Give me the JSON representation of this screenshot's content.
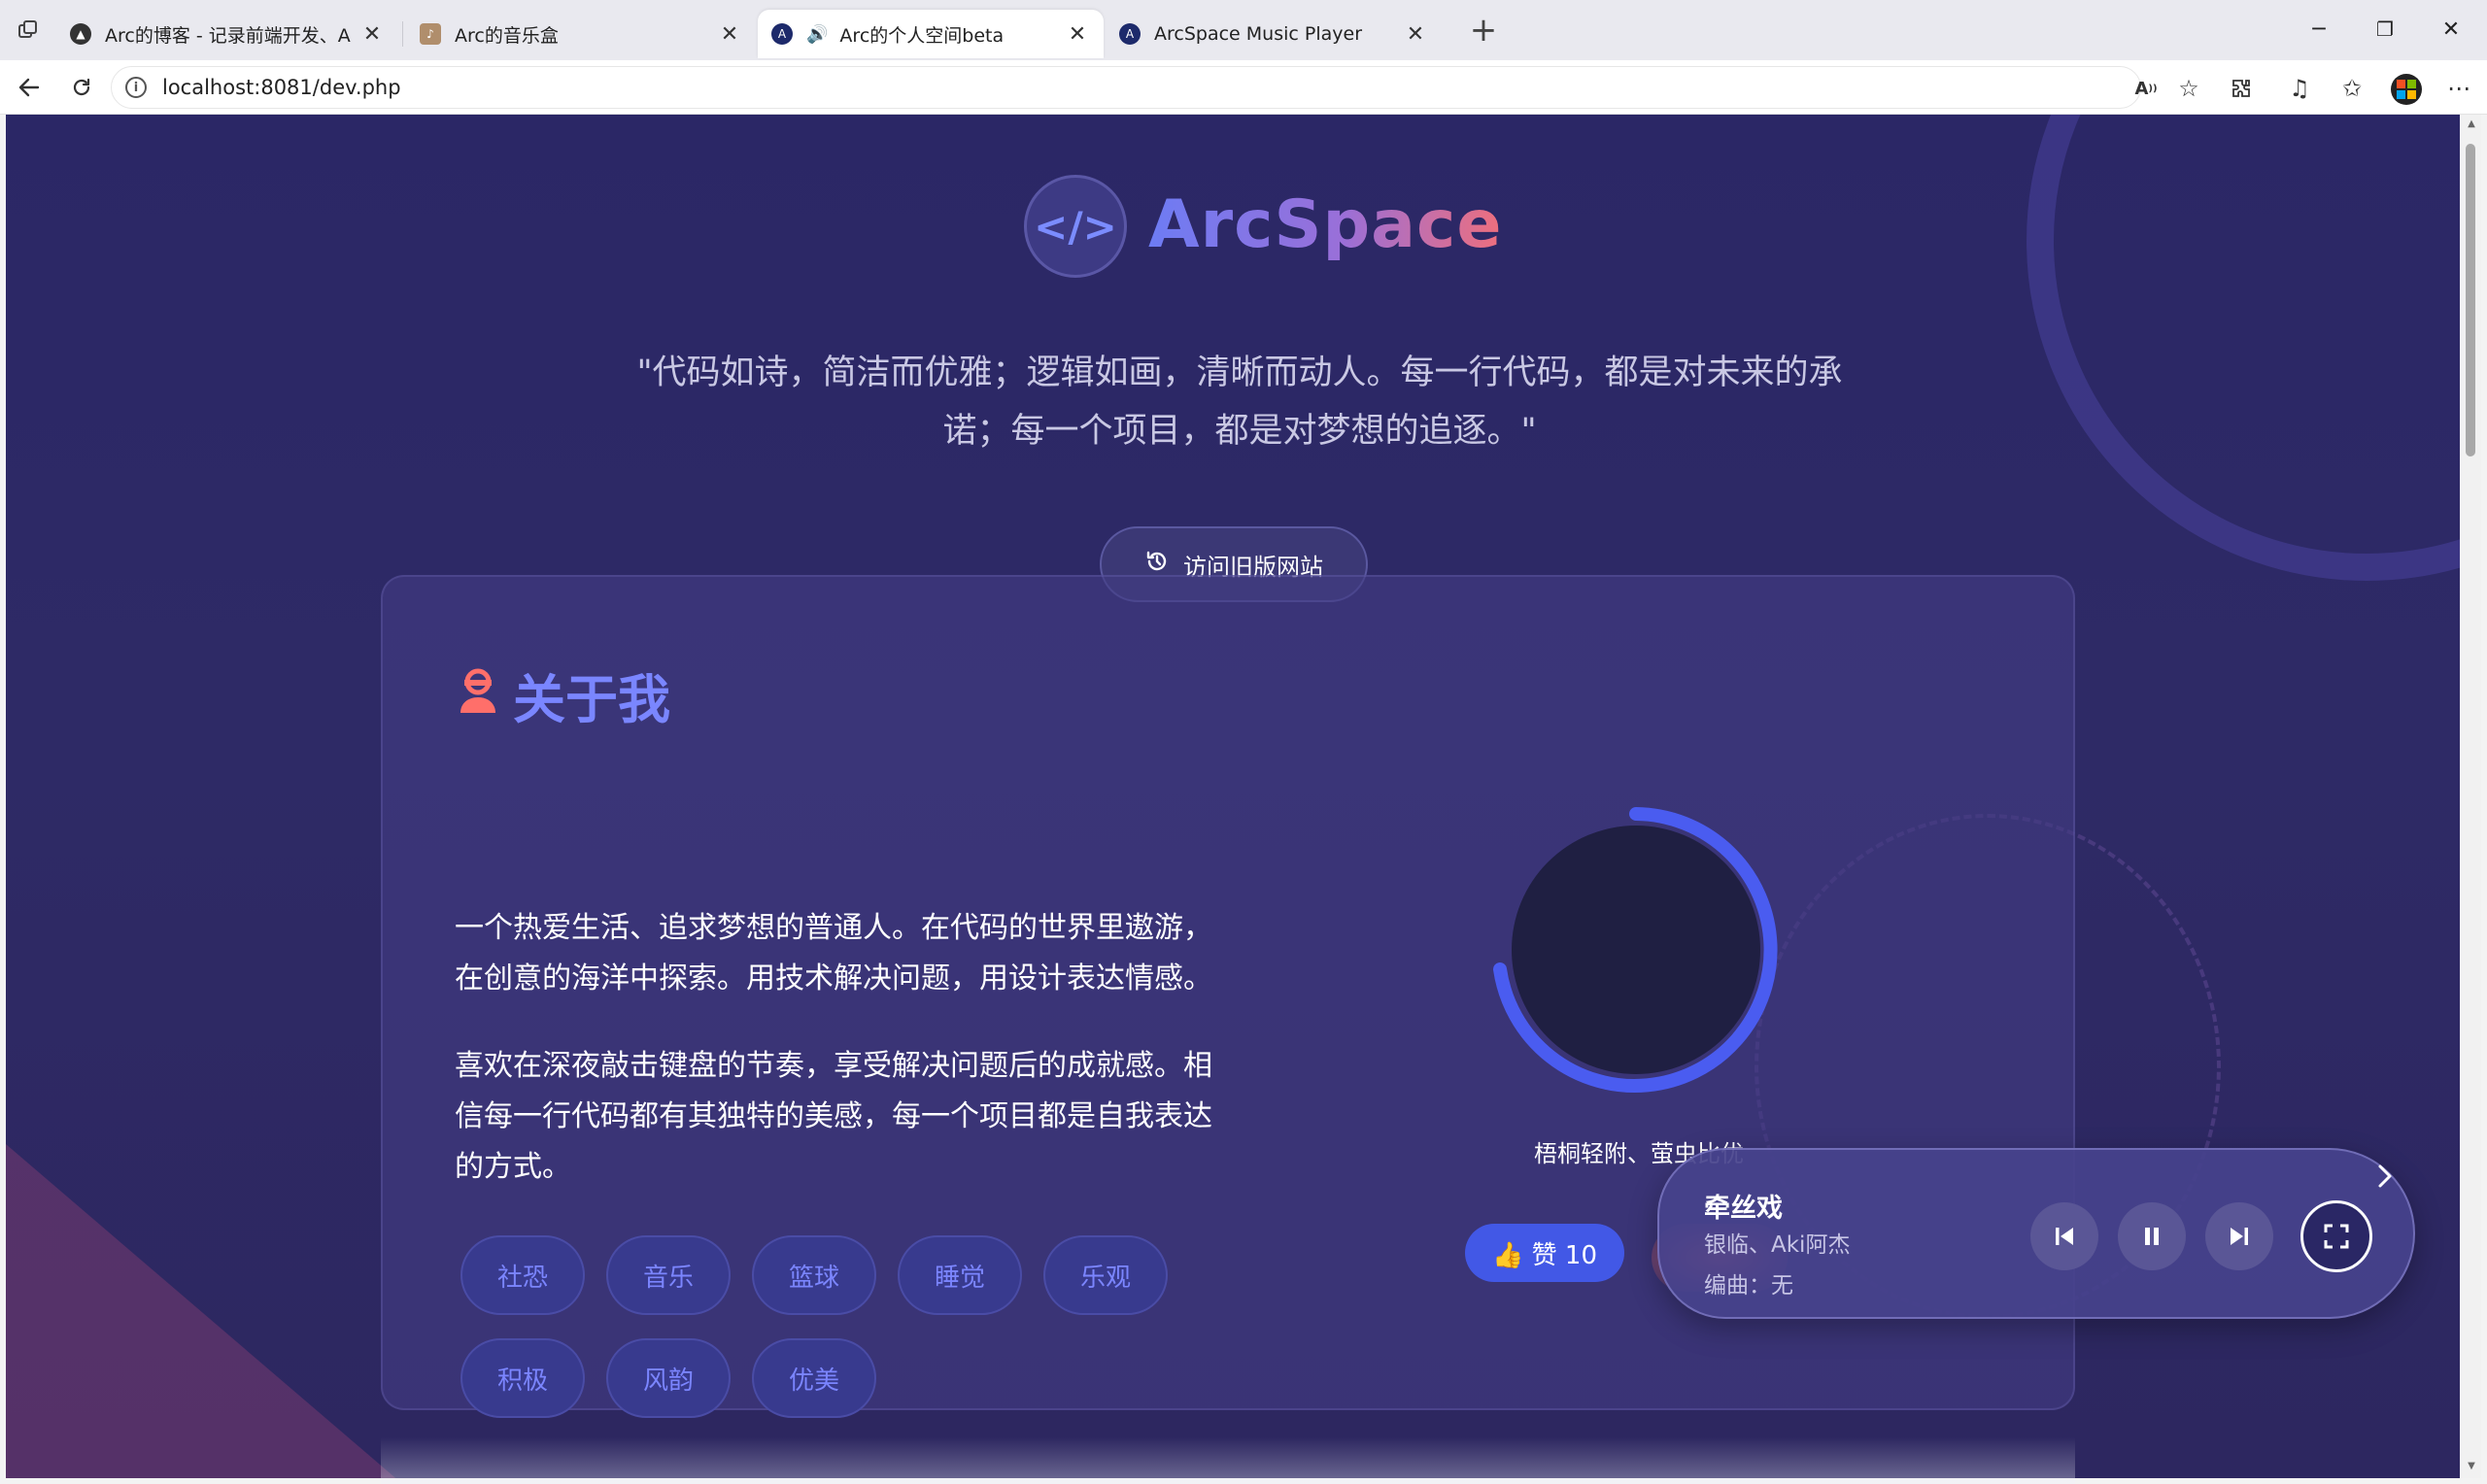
{
  "browser": {
    "tabs": [
      {
        "title": "Arc的博客 - 记录前端开发、AI探索",
        "close": "✕"
      },
      {
        "title": "Arc的音乐盒",
        "close": "✕"
      },
      {
        "title": "Arc的个人空间beta",
        "close": "✕",
        "audio": "🔊"
      },
      {
        "title": "ArcSpace Music Player",
        "close": "✕"
      }
    ],
    "new_tab": "+",
    "window": {
      "minimize": "─",
      "restore": "❐",
      "close": "✕"
    },
    "url": "localhost:8081/dev.php"
  },
  "hero": {
    "logo_glyph": "</>",
    "logo_text": "ArcSpace",
    "quote_line1": "\"代码如诗，简洁而优雅；逻辑如画，清晰而动人。每一行代码，都是对未来的承",
    "quote_line2": "诺；每一个项目，都是对梦想的追逐。\"",
    "old_site_label": "访问旧版网站"
  },
  "about": {
    "title": "关于我",
    "para1_line1": "一个热爱生活、追求梦想的普通人。在代码的世界里遨游，",
    "para1_line2": "在创意的海洋中探索。用技术解决问题，用设计表达情感。",
    "para2_line1": "喜欢在深夜敲击键盘的节奏，享受解决问题后的成就感。相",
    "para2_line2": "信每一行代码都有其独特的美感，每一个项目都是自我表达",
    "para2_line3": "的方式。",
    "tags": [
      "社恐",
      "音乐",
      "篮球",
      "睡觉",
      "乐观",
      "积极",
      "风韵",
      "优美"
    ],
    "avatar_caption": "梧桐轻附、萤虫比优",
    "like_label": "👍 赞 10"
  },
  "player": {
    "title": "牵丝戏",
    "artist": "银临、Aki阿杰",
    "composer": "编曲：无"
  },
  "colors": {
    "bg": "#2b2766",
    "accent": "#7a86ff",
    "like": "#4258e6",
    "avatar_ring": "#4a5cf0"
  }
}
